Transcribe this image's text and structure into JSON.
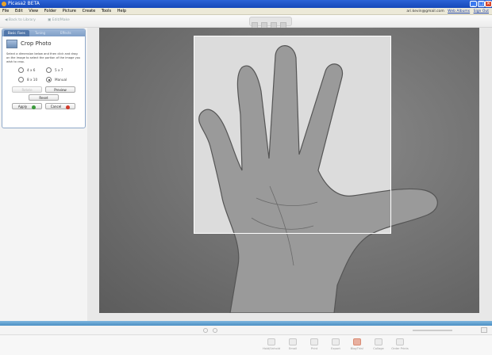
{
  "window": {
    "title": "Picasa2 BETA",
    "controls": [
      "_",
      "□",
      "✕"
    ]
  },
  "menu": {
    "items": [
      "File",
      "Edit",
      "View",
      "Folder",
      "Picture",
      "Create",
      "Tools",
      "Help"
    ],
    "account_email": "ari.kevin@gmail.com",
    "account_links": [
      "Web Albums",
      "Sign Out"
    ]
  },
  "toolbar": {
    "back_label": "Back to Library",
    "edit_label": "Edit/Make"
  },
  "panel": {
    "tabs": [
      "Basic Fixes",
      "Tuning",
      "Effects"
    ],
    "title": "Crop Photo",
    "description": "Select a dimension below and then click and drag on the image to select the portion of the image you wish to crop.",
    "ratios": [
      {
        "label": "4 x 6",
        "checked": false
      },
      {
        "label": "5 x 7",
        "checked": false
      },
      {
        "label": "8 x 10",
        "checked": false
      },
      {
        "label": "Manual",
        "checked": true
      }
    ],
    "buttons": {
      "rotate": "Rotate",
      "preview": "Preview",
      "reset": "Reset",
      "apply": "Apply",
      "cancel": "Cancel"
    }
  },
  "tray": {
    "buttons": [
      "Hold/Unhold",
      "Email",
      "Print",
      "Export",
      "BlogThis!",
      "Collage",
      "Order Prints"
    ]
  }
}
